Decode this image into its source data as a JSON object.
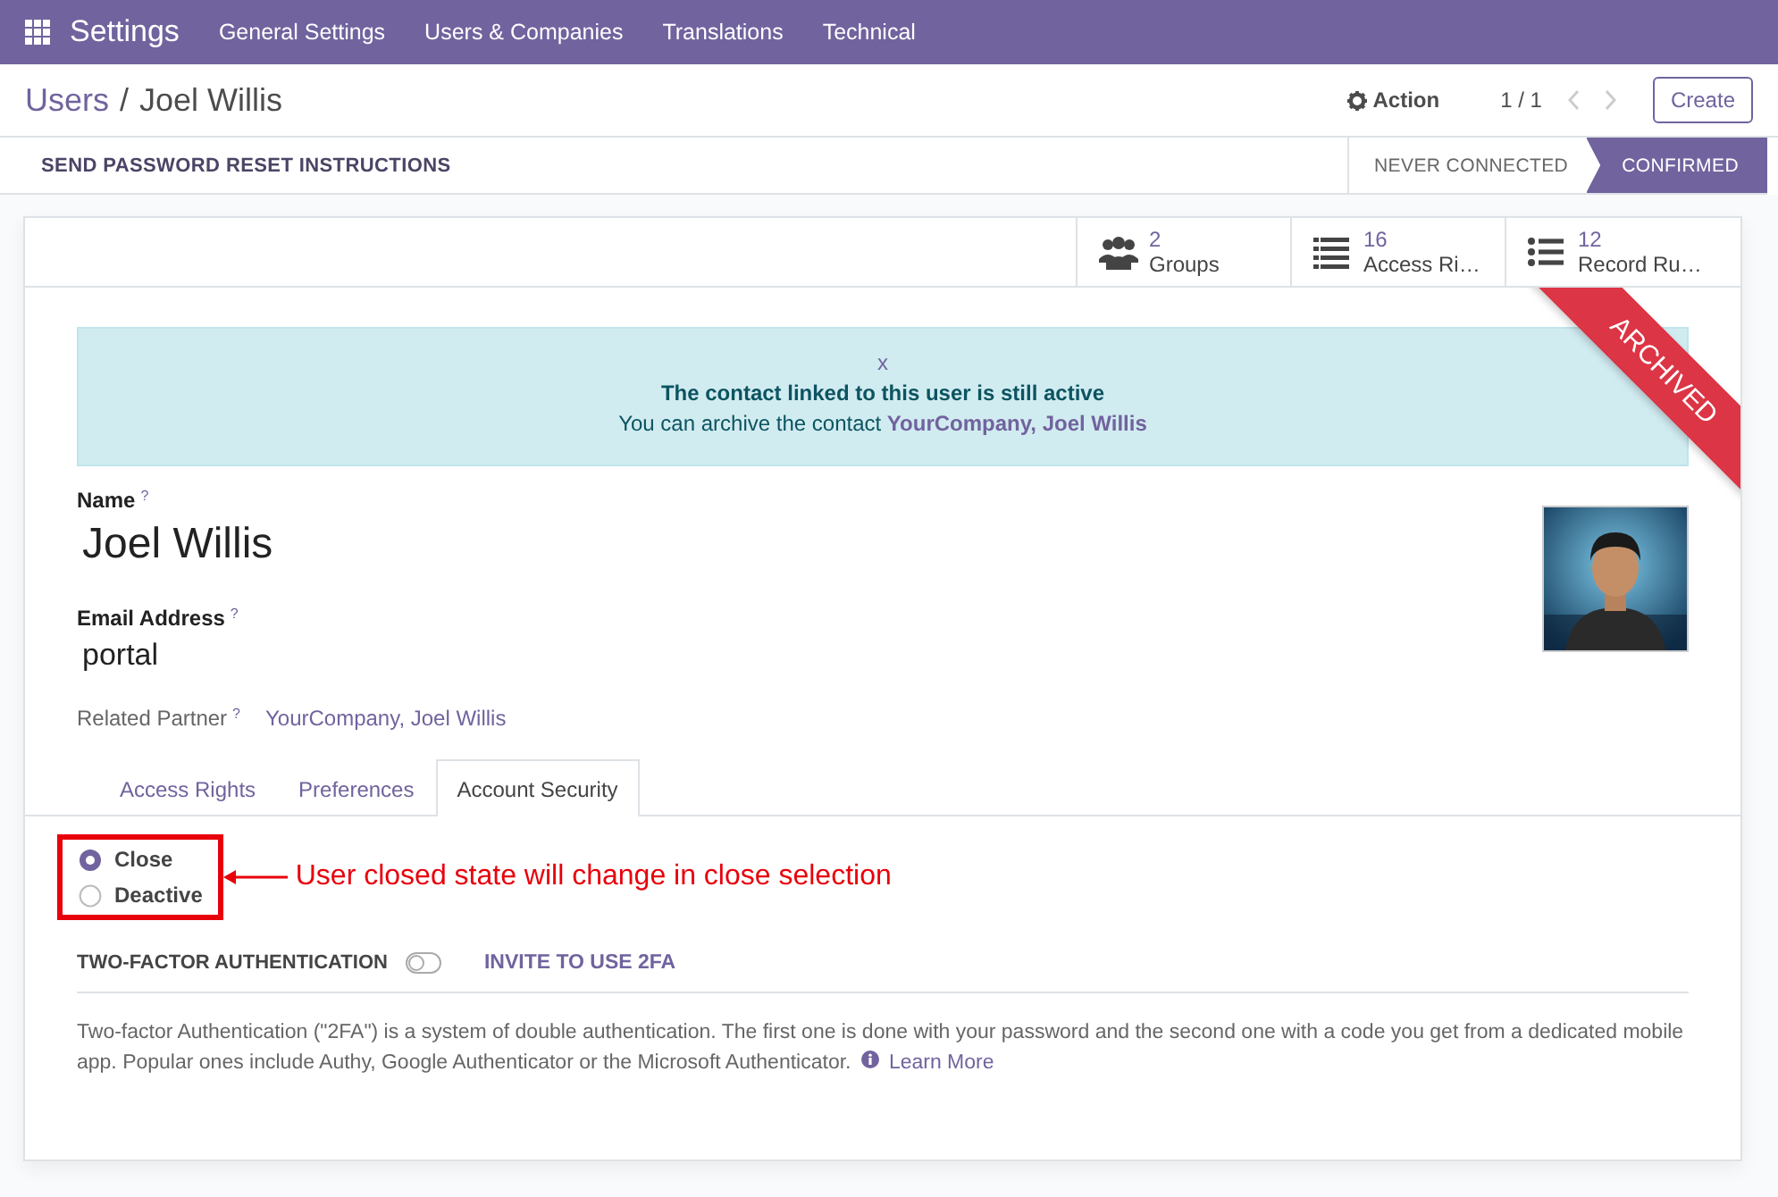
{
  "navbar": {
    "app": "Settings",
    "menus": [
      "General Settings",
      "Users & Companies",
      "Translations",
      "Technical"
    ]
  },
  "breadcrumb": {
    "parent": "Users",
    "separator": "/",
    "current": "Joel Willis"
  },
  "control_panel": {
    "action": "Action",
    "pager": "1 / 1",
    "create": "Create"
  },
  "status_bar": {
    "buttons": [
      "SEND PASSWORD RESET INSTRUCTIONS"
    ],
    "stages": [
      {
        "label": "NEVER CONNECTED",
        "selected": false
      },
      {
        "label": "CONFIRMED",
        "selected": true
      }
    ]
  },
  "smart_buttons": [
    {
      "kind": "groups",
      "count": "2",
      "label": "Groups"
    },
    {
      "kind": "list",
      "count": "16",
      "label": "Access Ri…"
    },
    {
      "kind": "bullets",
      "count": "12",
      "label": "Record Ru…"
    }
  ],
  "ribbon": "ARCHIVED",
  "alert": {
    "close": "x",
    "title": "The contact linked to this user is still active",
    "text": "You can archive the contact **YourCompany, Joel Willis**"
  },
  "name": {
    "label": "Name",
    "help": "?",
    "value": "Joel Willis"
  },
  "email": {
    "label": "Email Address",
    "help": "?",
    "value": "portal"
  },
  "related_partner": {
    "label": "Related Partner",
    "help": "?",
    "value": "YourCompany, Joel Willis"
  },
  "tabs": [
    {
      "label": "Access Rights",
      "selected": false
    },
    {
      "label": "Preferences",
      "selected": false
    },
    {
      "label": "Account Security",
      "selected": true
    }
  ],
  "state_options": [
    {
      "label": "Close",
      "selected": true
    },
    {
      "label": "Deactive",
      "selected": false
    }
  ],
  "annotation": "User closed state will change in close selection",
  "two_factor": {
    "label": "TWO-FACTOR AUTHENTICATION",
    "on": false,
    "invite": "INVITE TO USE 2FA"
  },
  "description": "Two-factor Authentication (\"2FA\") is a system of double authentication. The first one is done with your password and the second one with a code you get from a dedicated mobile app. Popular ones include Authy, Google Authenticator or the Microsoft Authenticator.",
  "learn_more": "Learn More"
}
